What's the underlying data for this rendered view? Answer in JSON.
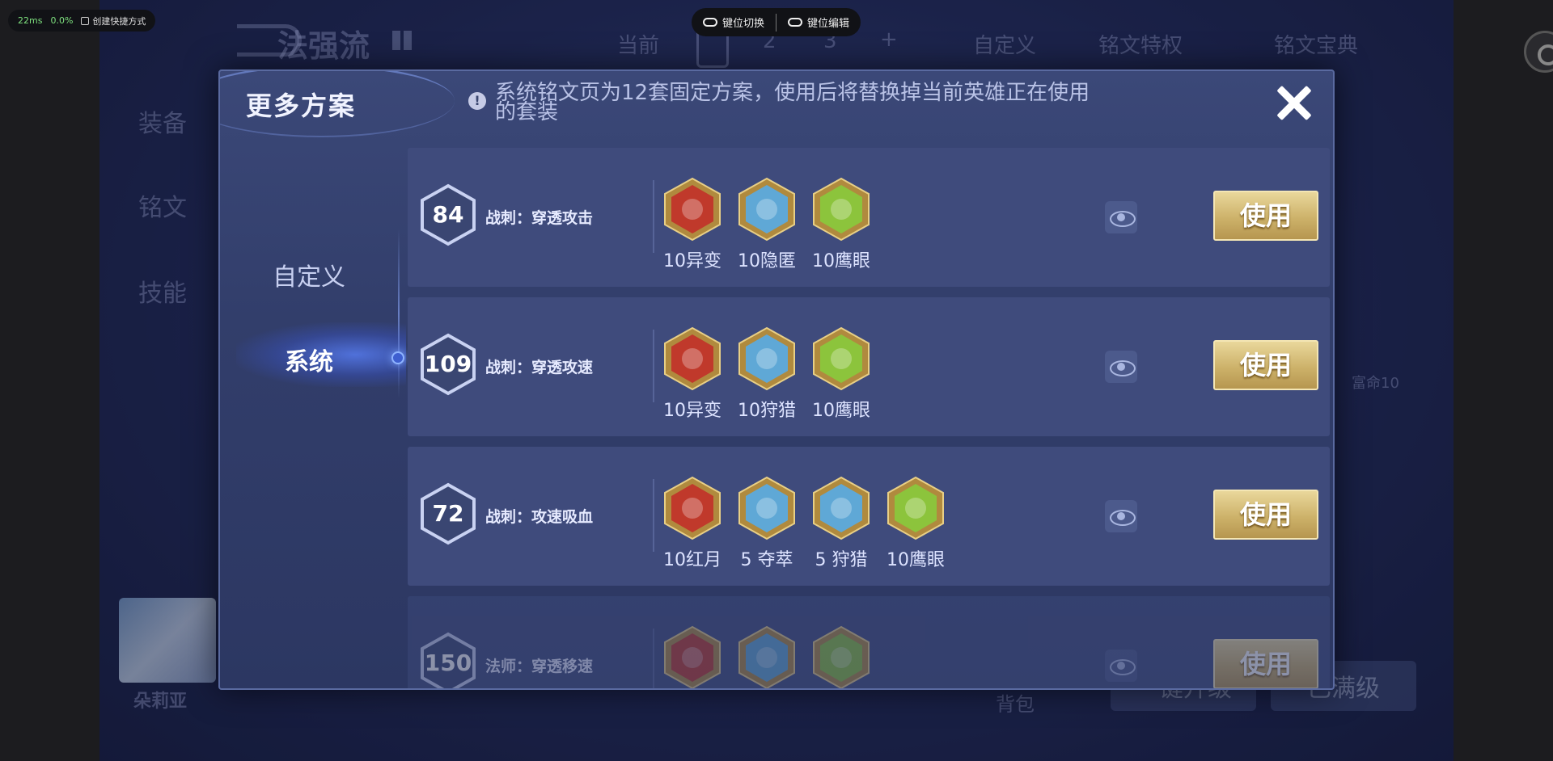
{
  "overlay": {
    "latency": "22ms",
    "loss": "0.0%",
    "shortcut": "创建快捷方式",
    "key_switch": "键位切换",
    "key_edit": "键位编辑"
  },
  "background": {
    "title": "法强流",
    "tabs": [
      "当前",
      "2",
      "3",
      "+"
    ],
    "custom": "自定义",
    "privilege": "铭文特权",
    "codex": "铭文宝典",
    "side": [
      "装备",
      "铭文",
      "技能"
    ],
    "hero_name": "朵莉亚",
    "bag": "背包",
    "rune_side": "富命10",
    "max_level": "已满级",
    "upgrade": "一键升级"
  },
  "modal": {
    "title": "更多方案",
    "info": "系统铭文页为12套固定方案，使用后将替换掉当前英雄正在使用的套装",
    "nav": [
      {
        "label": "自定义",
        "active": false
      },
      {
        "label": "系统",
        "active": true
      }
    ],
    "use_label": "使用",
    "plans": [
      {
        "level": "84",
        "name": "战刺：穿透攻击",
        "runes": [
          {
            "label": "10异变",
            "color": "#c0392b",
            "icon": "red-rune-icon"
          },
          {
            "label": "10隐匿",
            "color": "#5fa8d6",
            "icon": "blue-rune-icon"
          },
          {
            "label": "10鹰眼",
            "color": "#8cc43c",
            "icon": "green-rune-icon"
          }
        ]
      },
      {
        "level": "109",
        "name": "战刺：穿透攻速",
        "runes": [
          {
            "label": "10异变",
            "color": "#c0392b",
            "icon": "red-rune-icon"
          },
          {
            "label": "10狩猎",
            "color": "#5fa8d6",
            "icon": "blue-rune-icon"
          },
          {
            "label": "10鹰眼",
            "color": "#8cc43c",
            "icon": "green-rune-icon"
          }
        ]
      },
      {
        "level": "72",
        "name": "战刺：攻速吸血",
        "runes": [
          {
            "label": "10红月",
            "color": "#c0392b",
            "icon": "red-rune-icon"
          },
          {
            "label": "5 夺萃",
            "color": "#5fa8d6",
            "icon": "blue-rune-icon"
          },
          {
            "label": "5 狩猎",
            "color": "#5fa8d6",
            "icon": "blue-rune-icon"
          },
          {
            "label": "10鹰眼",
            "color": "#8cc43c",
            "icon": "green-rune-icon"
          }
        ]
      },
      {
        "level": "150",
        "name": "法师：穿透移速",
        "runes": [
          {
            "label": "",
            "color": "#c0392b",
            "icon": "red-rune-icon"
          },
          {
            "label": "",
            "color": "#5fa8d6",
            "icon": "blue-rune-icon"
          },
          {
            "label": "",
            "color": "#8cc43c",
            "icon": "green-rune-icon"
          }
        ]
      }
    ]
  }
}
